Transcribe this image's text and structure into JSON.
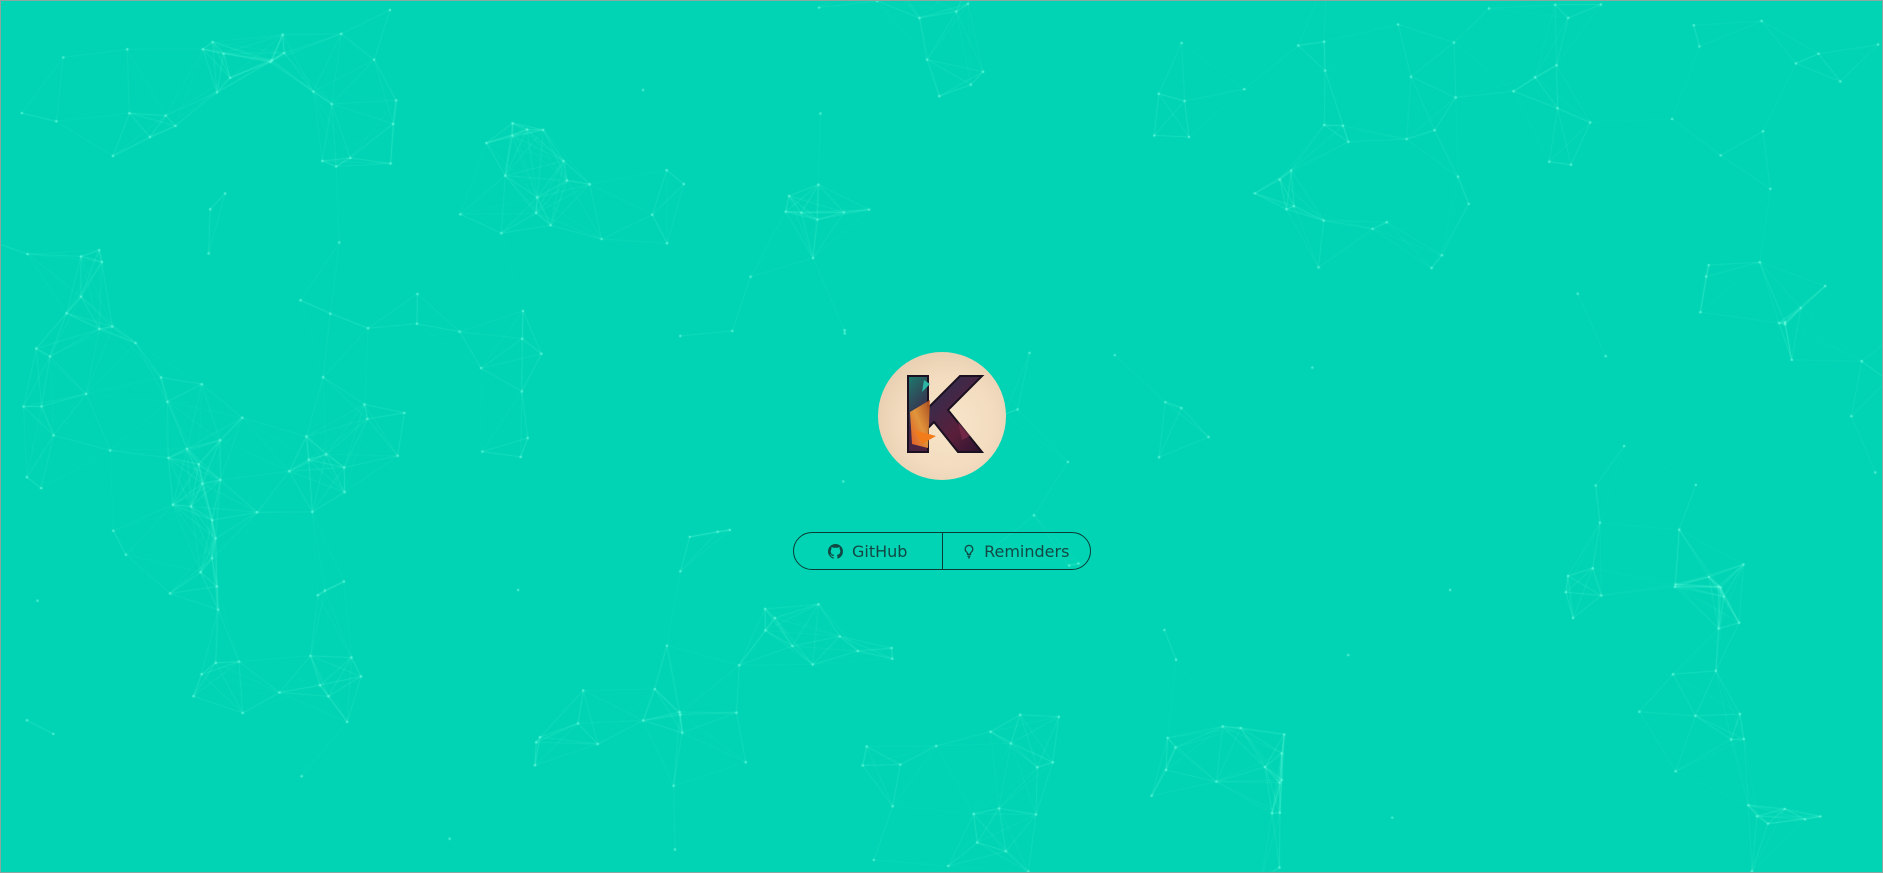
{
  "theme": {
    "background": "#00d4b4",
    "network_color": "#5ff5d6",
    "text_color": "#124843",
    "border_color": "#0b3b36"
  },
  "logo": {
    "letter": "K",
    "description_icon": "k-letter-logo"
  },
  "buttons": [
    {
      "label": "GitHub",
      "icon": "github-icon"
    },
    {
      "label": "Reminders",
      "icon": "lightbulb-icon"
    }
  ]
}
